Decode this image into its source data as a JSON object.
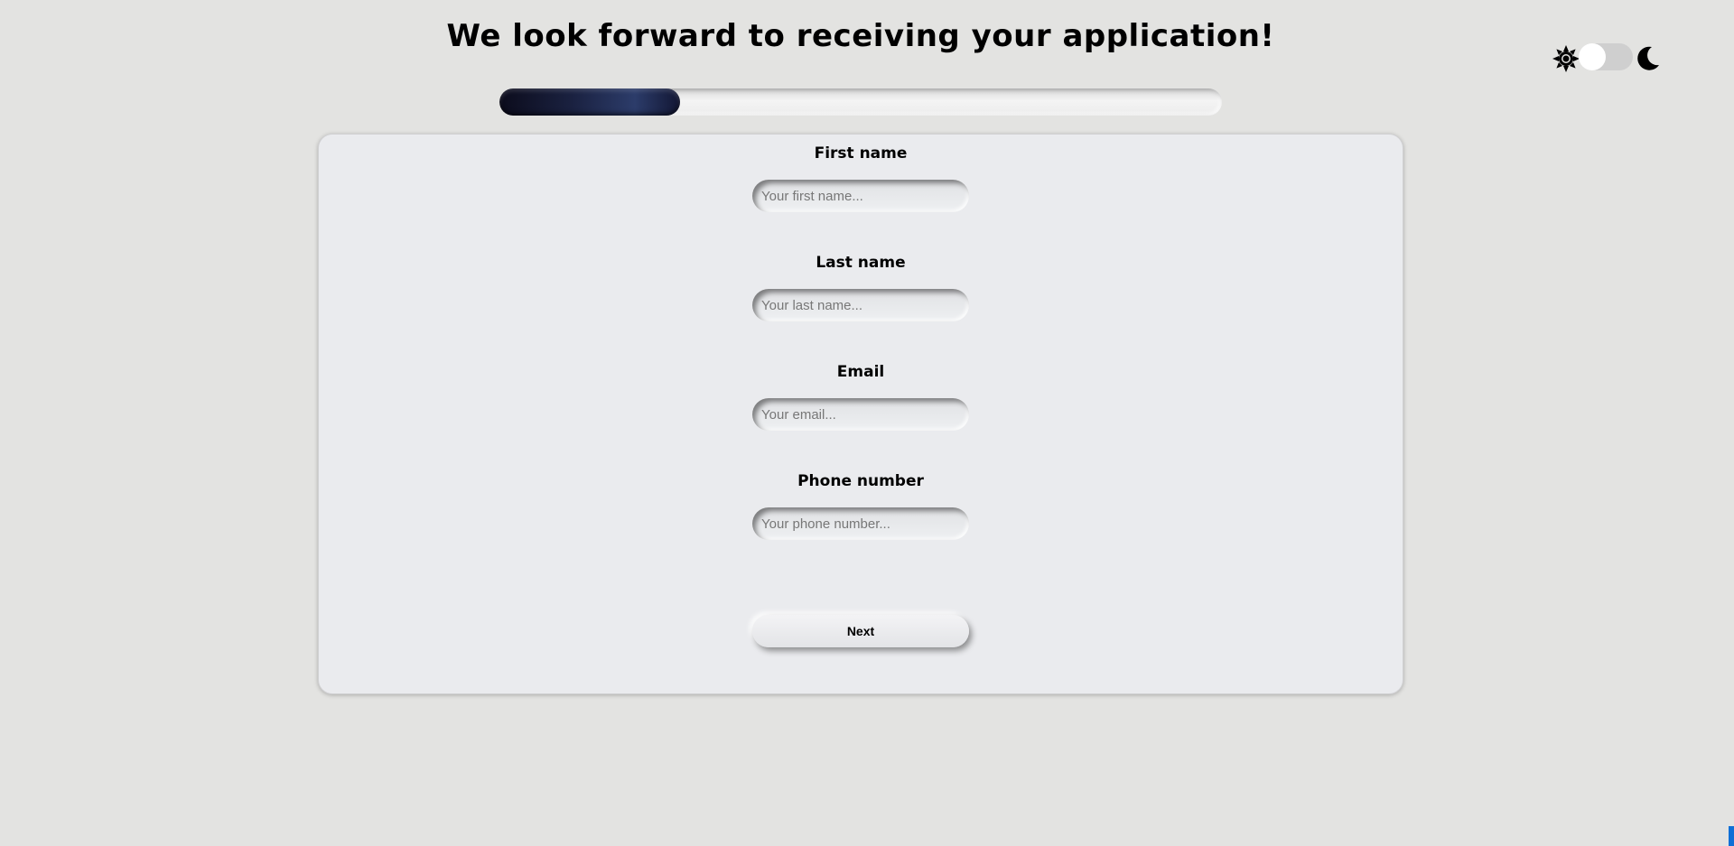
{
  "header": {
    "title": "We look forward to receiving your application!"
  },
  "theme_toggle": {
    "light_icon": "sun-icon",
    "dark_icon": "moon-icon",
    "state": "light"
  },
  "progress": {
    "percent": 25,
    "fill_color": "#1a2140"
  },
  "form": {
    "fields": [
      {
        "label": "First name",
        "placeholder": "Your first name...",
        "value": ""
      },
      {
        "label": "Last name",
        "placeholder": "Your last name...",
        "value": ""
      },
      {
        "label": "Email",
        "placeholder": "Your email...",
        "value": ""
      },
      {
        "label": "Phone number",
        "placeholder": "Your phone number...",
        "value": ""
      }
    ],
    "next_label": "Next"
  },
  "colors": {
    "background": "#e3e3e1",
    "card": "#eaebee",
    "accent": "#1a2140"
  }
}
